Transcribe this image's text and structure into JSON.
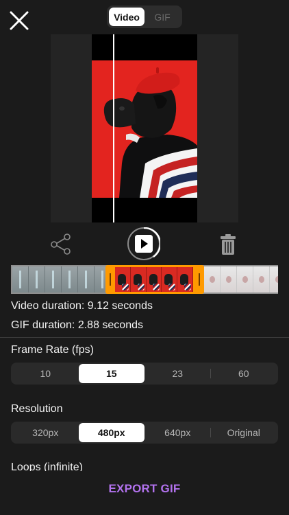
{
  "header": {
    "close_icon": "close-icon",
    "modes": [
      {
        "label": "Video",
        "active": true
      },
      {
        "label": "GIF",
        "active": false
      }
    ]
  },
  "preview": {
    "icons": {
      "share": "share-icon",
      "play": "play-icon",
      "trash": "trash-icon"
    }
  },
  "info": {
    "video_duration": "Video duration: 9.12 seconds",
    "gif_duration": "GIF duration: 2.88 seconds"
  },
  "frame_rate": {
    "label": "Frame Rate (fps)",
    "options": [
      "10",
      "15",
      "23",
      "60"
    ],
    "selected": "15"
  },
  "resolution": {
    "label": "Resolution",
    "options": [
      "320px",
      "480px",
      "640px",
      "Original"
    ],
    "selected": "480px"
  },
  "loops": {
    "label": "Loops (infinite)"
  },
  "export": {
    "label": "EXPORT GIF"
  },
  "colors": {
    "background": "#1b1b1b",
    "accent_orange": "#ff9a00",
    "export_purple": "#b272ee",
    "photo_red": "#e3241f"
  }
}
